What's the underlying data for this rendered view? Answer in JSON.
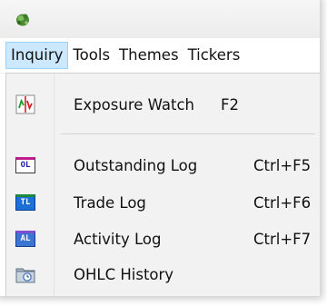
{
  "menubar": {
    "items": [
      {
        "label": "Inquiry"
      },
      {
        "label": "Tools"
      },
      {
        "label": "Themes"
      },
      {
        "label": "Tickers"
      }
    ]
  },
  "dropdown": {
    "items": [
      {
        "label": "Exposure Watch",
        "shortcut": "F2",
        "icon": "exposure-watch-icon"
      },
      {
        "label": "Outstanding Log",
        "shortcut": "Ctrl+F5",
        "icon": "ol-icon",
        "icon_text": "OL"
      },
      {
        "label": "Trade Log",
        "shortcut": "Ctrl+F6",
        "icon": "tl-icon",
        "icon_text": "TL"
      },
      {
        "label": "Activity Log",
        "shortcut": "Ctrl+F7",
        "icon": "al-icon",
        "icon_text": "AL"
      },
      {
        "label": "OHLC History",
        "shortcut": "",
        "icon": "ohlc-history-icon"
      }
    ]
  },
  "colors": {
    "highlight_bg": "#cce8ff",
    "highlight_border": "#99d1ff",
    "menu_bg": "#f2f2f2"
  }
}
